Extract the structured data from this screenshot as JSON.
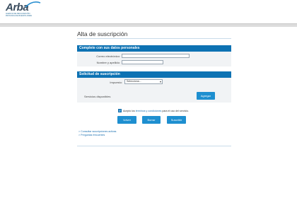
{
  "header": {
    "logo_text": "Arba",
    "logo_subtitle": "AGENCIA DE RECAUDACIÓN PROVINCIA DE BUENOS AIRES"
  },
  "page": {
    "title": "Alta de suscripción"
  },
  "personal": {
    "section_title": "Complete con sus datos personales",
    "email_label": "Correo electrónico:",
    "email_value": "",
    "name_label": "Nombre y apellido:",
    "name_value": ""
  },
  "subscription": {
    "section_title": "Solicitud de suscripción",
    "tax_label": "Impuesto:",
    "tax_selected": "Selecciona...",
    "services_label": "Servicios disponibles",
    "add_label": "Agregar"
  },
  "terms": {
    "checked": true,
    "prefix": "Acepto los ",
    "link_text": "términos y condiciones",
    "suffix": " para el uso del servicio."
  },
  "actions": {
    "back": "Volver",
    "reset": "Borrar",
    "submit": "Suscribir"
  },
  "links": [
    "> Consultar suscripciones activas",
    "> Preguntas frecuentes"
  ],
  "colors": {
    "accent": "#0d72b3",
    "button": "#1e8fd0",
    "panel": "#f1f3f5"
  }
}
